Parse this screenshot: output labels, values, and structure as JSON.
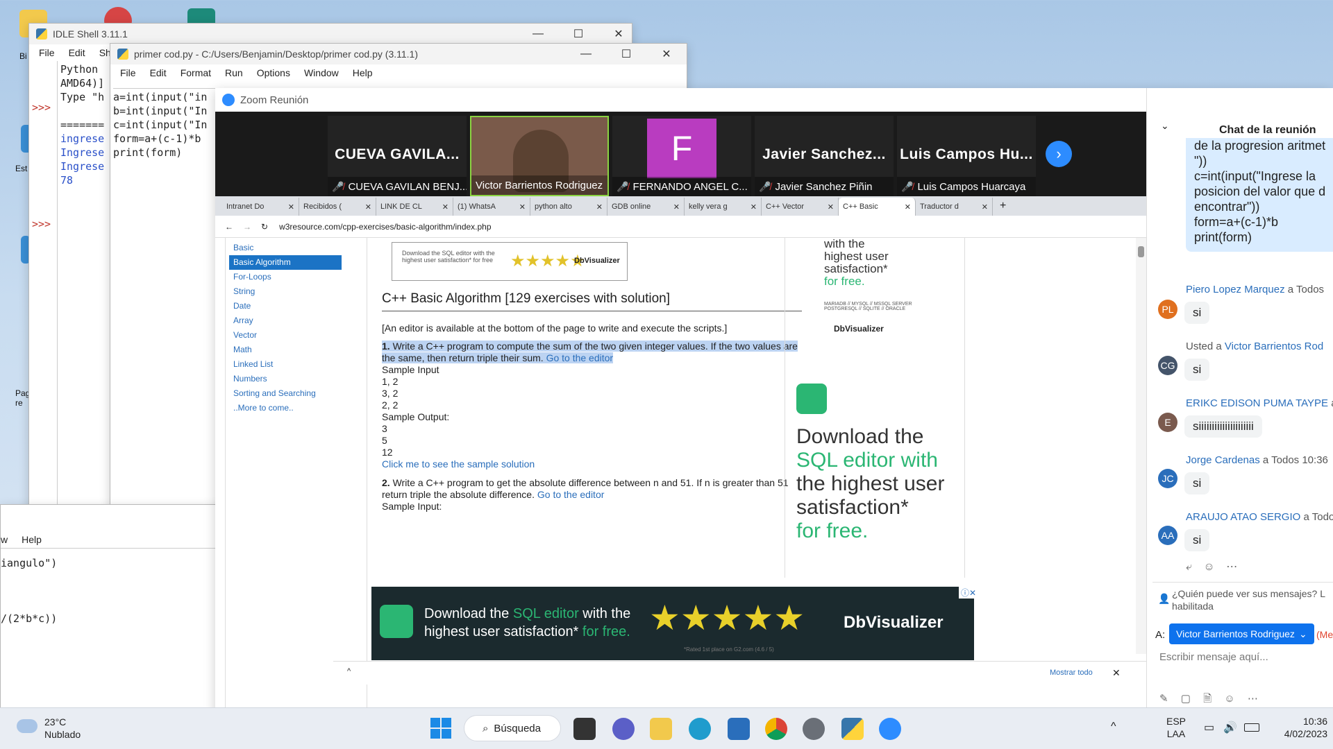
{
  "desktop": {
    "icon_labels": [
      "Bi",
      "Est",
      "Pag re"
    ]
  },
  "idle_shell": {
    "title": "IDLE Shell 3.11.1",
    "menu": [
      "File",
      "Edit",
      "She"
    ],
    "lines": [
      "Python",
      "AMD64)]",
      "Type \"h",
      "",
      "=======",
      "ingrese",
      "Ingrese",
      "Ingrese",
      "78"
    ],
    "prompts": [
      ">>>",
      ">>>",
      ">>>"
    ]
  },
  "editor": {
    "title": "primer cod.py - C:/Users/Benjamin/Desktop/primer cod.py (3.11.1)",
    "menu": [
      "File",
      "Edit",
      "Format",
      "Run",
      "Options",
      "Window",
      "Help"
    ],
    "lines": [
      "a=int(input(\"in",
      "b=int(input(\"In",
      "c=int(input(\"In",
      "form=a+(c-1)*b",
      "print(form)"
    ]
  },
  "small_window": {
    "menu": [
      "w",
      "Help"
    ],
    "lines": [
      "iangulo\")",
      "/(2*b*c))"
    ]
  },
  "zoom": {
    "title": "Zoom Reunión",
    "participants": [
      {
        "big": "CUEVA GAVILA...",
        "name": "CUEVA GAVILAN BENJ...",
        "muted": true
      },
      {
        "big": "",
        "name": "Victor Barrientos Rodriguez",
        "muted": false
      },
      {
        "big": "F",
        "name": "FERNANDO ANGEL C...",
        "muted": true
      },
      {
        "big": "Javier Sanchez...",
        "name": "Javier Sanchez Piñin",
        "muted": true
      },
      {
        "big": "Luis Campos Hu...",
        "name": "Luis Campos Huarcaya",
        "muted": true
      }
    ]
  },
  "browser": {
    "tabs": [
      {
        "label": "Intranet Do",
        "active": false
      },
      {
        "label": "Recibidos (",
        "active": false
      },
      {
        "label": "LINK DE CL",
        "active": false
      },
      {
        "label": "(1) WhatsA",
        "active": false
      },
      {
        "label": "python alto",
        "active": false
      },
      {
        "label": "GDB online",
        "active": false
      },
      {
        "label": "kelly vera g",
        "active": false
      },
      {
        "label": "C++ Vector",
        "active": false
      },
      {
        "label": "C++ Basic",
        "active": true
      },
      {
        "label": "Traductor d",
        "active": false
      }
    ],
    "url": "w3resource.com/cpp-exercises/basic-algorithm/index.php",
    "sidebar": [
      "Basic",
      "Basic Algorithm",
      "For-Loops",
      "String",
      "Date",
      "Array",
      "Vector",
      "Math",
      "Linked List",
      "Numbers",
      "Sorting and Searching",
      "..More to come.."
    ],
    "ad_top": {
      "line1": "Download the SQL editor with the",
      "line2": "highest user satisfaction* for free",
      "brand": "DbVisualizer"
    },
    "heading": "C++ Basic Algorithm [129 exercises with solution]",
    "note": "[An editor is available at the bottom of the page to write and execute the scripts.]",
    "ex1": {
      "num": "1.",
      "text": "Write a C++ program to compute the sum of the two given integer values. If the two values are the same, then return triple their sum.",
      "link": "Go to the editor"
    },
    "sample_input_label": "Sample Input",
    "sample_inputs": [
      "1, 2",
      "3, 2",
      "2, 2"
    ],
    "sample_output_label": "Sample Output:",
    "sample_outputs": [
      "3",
      "5",
      "12"
    ],
    "solution_link": "Click me to see the sample solution",
    "ex2": {
      "num": "2.",
      "text": "Write a C++ program to get the absolute difference between n and 51. If n is greater than 51 return triple the absolute difference.",
      "link": "Go to the editor"
    },
    "sample_input2": "Sample Input:",
    "ad_right": {
      "top_lines": [
        "with the",
        "highest user",
        "satisfaction*",
        "for free."
      ],
      "db_list": "MARIADB // MYSQL // MSSQL SERVER POSTGRESQL // SQLITE // ORACLE",
      "brand": "DbVisualizer",
      "big_lines": [
        "Download the",
        "SQL editor with",
        "the highest user",
        "satisfaction*",
        "for free."
      ]
    },
    "ad_bottom": {
      "line1a": "Download the ",
      "line1b": "SQL editor",
      "line1c": " with the",
      "line2a": "highest user satisfaction*",
      "line2b": " for free.",
      "brand": "DbVisualizer",
      "rated": "*Rated 1st place on G2.com (4.6 / 5)"
    },
    "download_bar": {
      "show_all": "Mostrar todo"
    }
  },
  "chat": {
    "title": "Chat de la reunión",
    "code_lines": [
      "de la progresion aritmet",
      "\"))",
      "c=int(input(\"Ingrese la",
      "posicion del valor que d",
      "encontrar\"))",
      "form=a+(c-1)*b",
      "print(form)"
    ],
    "messages": [
      {
        "initials": "PL",
        "color": "#e0701f",
        "name": "Piero Lopez Marquez",
        "to": "a Todos",
        "text": "si"
      },
      {
        "initials": "CG",
        "color": "#44546a",
        "name": "Victor Barrientos Rod",
        "prefix": "Usted a ",
        "to": "",
        "text": "si"
      },
      {
        "initials": "E",
        "color": "#7a5a4e",
        "name": "ERIKC EDISON PUMA TAYPE",
        "to": "a",
        "text": "siiiiiiiiiiiiiiiiiiiii"
      },
      {
        "initials": "JC",
        "color": "#2a6ebb",
        "name": "Jorge Cardenas",
        "to": "a Todos 10:36",
        "text": "si"
      },
      {
        "initials": "AA",
        "color": "#2a6ebb",
        "name": "ARAUJO ATAO SERGIO",
        "to": "a Todo",
        "text": "si"
      }
    ],
    "who_can_see": "¿Quién puede ver sus mensajes? L",
    "enabled": "habilitada",
    "to_label": "A:",
    "recipient": "Victor Barrientos Rodriguez",
    "recipient_suffix": "(Me",
    "placeholder": "Escribir mensaje aquí..."
  },
  "taskbar": {
    "temp": "23°C",
    "weather": "Nublado",
    "search": "Búsqueda",
    "lang1": "ESP",
    "lang2": "LAA",
    "time": "10:36",
    "date": "4/02/2023"
  }
}
